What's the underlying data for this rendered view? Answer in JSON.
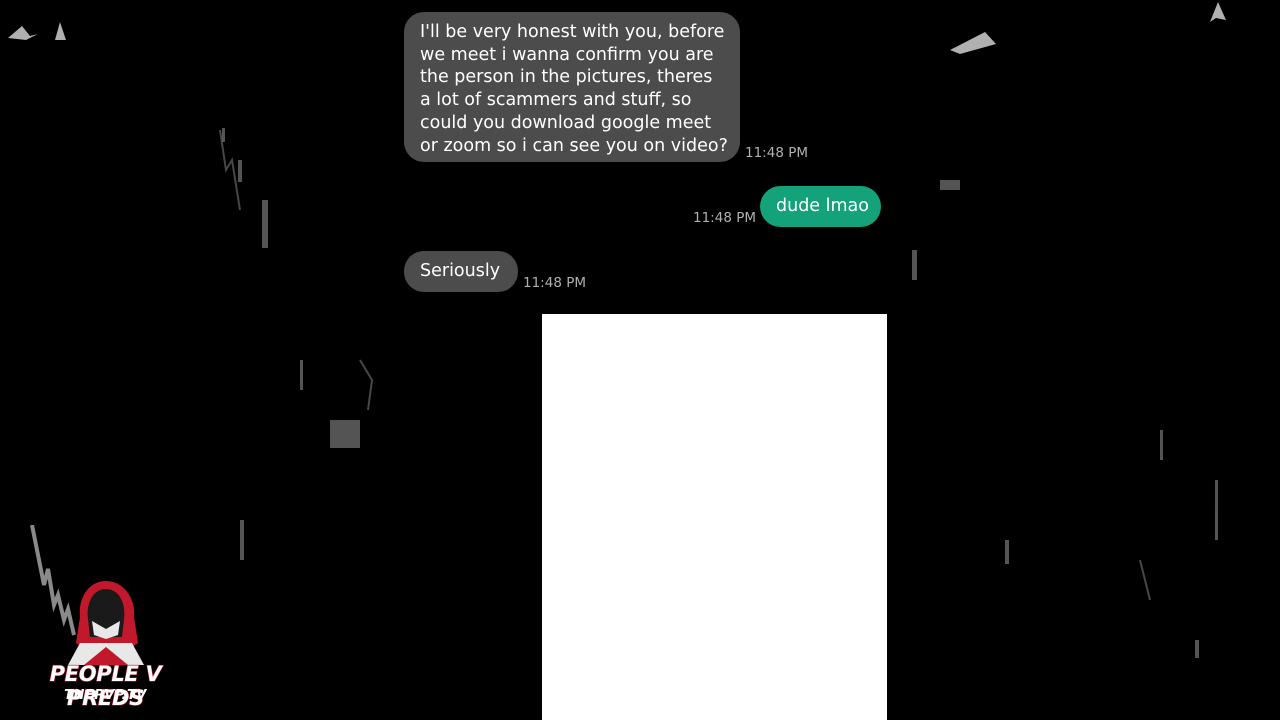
{
  "messages": [
    {
      "direction": "incoming",
      "text": "I'll be very honest with you, before\nwe meet i wanna confirm you are\nthe person in the pictures, theres\na lot of scammers and stuff, so\ncould you download google meet\nor zoom so i can see you on video?",
      "time": "11:48 PM"
    },
    {
      "direction": "outgoing",
      "text": "dude lmao",
      "time": "11:48 PM"
    },
    {
      "direction": "incoming",
      "text": "Seriously",
      "time": "11:48 PM"
    }
  ],
  "watermark": {
    "title": "PEOPLE V PREDS",
    "subtitle": "THEPVP.TV",
    "icon": "hooded-figure-icon"
  },
  "colors": {
    "background": "#000000",
    "incoming_bubble": "#4c4c4c",
    "outgoing_bubble": "#13a27a",
    "timestamp": "#b0b0b0",
    "logo_accent": "#b0152a"
  }
}
